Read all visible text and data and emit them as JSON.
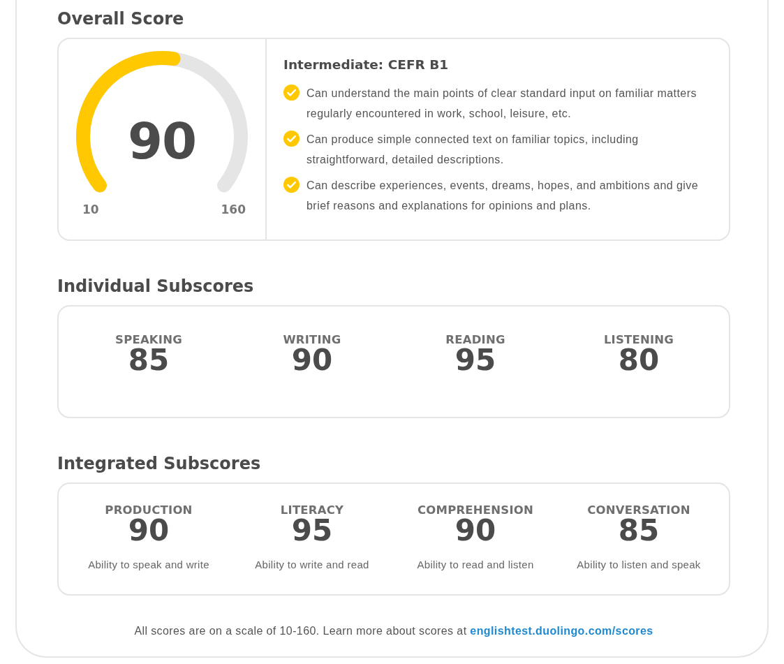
{
  "overall": {
    "heading": "Overall Score",
    "gauge": {
      "score": "90",
      "level": 0.533,
      "min_label": "10",
      "max_label": "160"
    },
    "level_title": "Intermediate: CEFR B1",
    "descriptors": [
      {
        "text": "Can understand the main points of clear standard input on familiar matters regularly encountered in work, school, leisure, etc."
      },
      {
        "text": "Can produce simple connected text on familiar topics, including straightforward, detailed descriptions."
      },
      {
        "text": "Can describe experiences, events, dreams, hopes, and ambitions and give brief reasons and explanations for opinions and plans."
      }
    ]
  },
  "individual": {
    "heading": "Individual Subscores",
    "items": [
      {
        "label": "SPEAKING",
        "score": "85"
      },
      {
        "label": "WRITING",
        "score": "90"
      },
      {
        "label": "READING",
        "score": "95"
      },
      {
        "label": "LISTENING",
        "score": "80"
      }
    ]
  },
  "integrated": {
    "heading": "Integrated Subscores",
    "items": [
      {
        "label": "PRODUCTION",
        "score": "90",
        "description": "Ability to speak and write"
      },
      {
        "label": "LITERACY",
        "score": "95",
        "description": "Ability to write and read"
      },
      {
        "label": "COMPREHENSION",
        "score": "90",
        "description": "Ability to read and listen"
      },
      {
        "label": "CONVERSATION",
        "score": "85",
        "description": "Ability to listen and speak"
      }
    ]
  },
  "footer": {
    "text": "All scores are on a scale of 10-160. Learn more about scores at",
    "link": "englishtest.duolingo.com/scores"
  }
}
